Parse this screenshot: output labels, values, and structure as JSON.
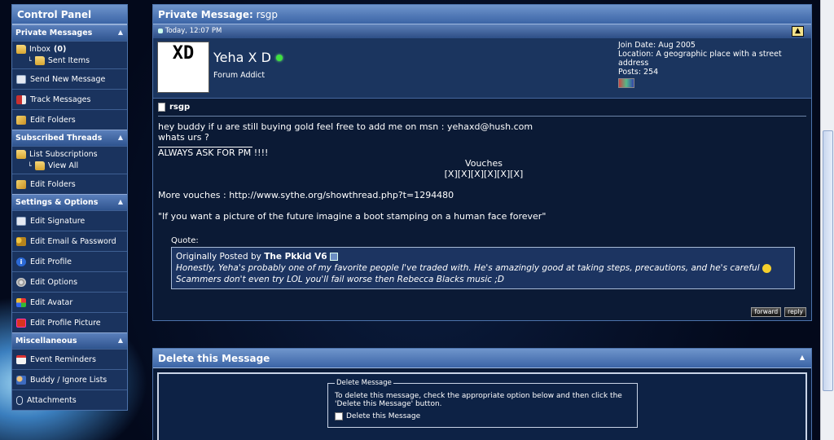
{
  "sidebar": {
    "title": "Control Panel",
    "sections": [
      {
        "title": "Private Messages",
        "items": [
          {
            "label": "Inbox",
            "count": "(0)",
            "sub": "Sent Items"
          },
          {
            "label": "Send New Message"
          },
          {
            "label": "Track Messages"
          },
          {
            "label": "Edit Folders"
          }
        ]
      },
      {
        "title": "Subscribed Threads",
        "items": [
          {
            "label": "List Subscriptions",
            "sub": "View All"
          },
          {
            "label": "Edit Folders"
          }
        ]
      },
      {
        "title": "Settings & Options",
        "items": [
          {
            "label": "Edit Signature"
          },
          {
            "label": "Edit Email & Password"
          },
          {
            "label": "Edit Profile"
          },
          {
            "label": "Edit Options"
          },
          {
            "label": "Edit Avatar"
          },
          {
            "label": "Edit Profile Picture"
          }
        ]
      },
      {
        "title": "Miscellaneous",
        "items": [
          {
            "label": "Event Reminders"
          },
          {
            "label": "Buddy / Ignore Lists"
          },
          {
            "label": "Attachments"
          }
        ]
      }
    ]
  },
  "pm": {
    "header_label": "Private Message:",
    "header_subject": "rsgp",
    "date": "Today, 12:07 PM",
    "user": {
      "name": "Yeha X D",
      "title": "Forum Addict",
      "avatar_top": "XD",
      "join": "Join Date: Aug 2005",
      "location": "Location: A geographic place with a street address",
      "posts": "Posts: 254"
    },
    "subject": "rsgp",
    "line1": "hey buddy if u are still buying gold feel free to add me on msn : yehaxd@hush.com",
    "line2": "whats urs ?",
    "sig_line": "ALWAYS ASK FOR PM !!!!",
    "vouches_title": "Vouches",
    "vouches": "[X][X][X][X][X][X]",
    "more_vouches": "More vouches : http://www.sythe.org/showthread.php?t=1294480",
    "quote_line": "\"If you want a picture of the future imagine a boot stamping on a human face forever\"",
    "quote_label": "Quote:",
    "quote_by_prefix": "Originally Posted by",
    "quote_author": "The Pkkid V6",
    "quote_text1": "Honestly, Yeha's probably one of my favorite people I've traded with. He's amazingly good at taking steps, precautions, and he's careful",
    "quote_text2": "Scammers don't even try LOL you'll fail worse then Rebecca Blacks music ;D",
    "forward": "forward",
    "reply": "reply"
  },
  "delete": {
    "title": "Delete this Message",
    "legend": "Delete Message",
    "text": "To delete this message, check the appropriate option below and then click the 'Delete this Message' button.",
    "checkbox": "Delete this Message"
  }
}
